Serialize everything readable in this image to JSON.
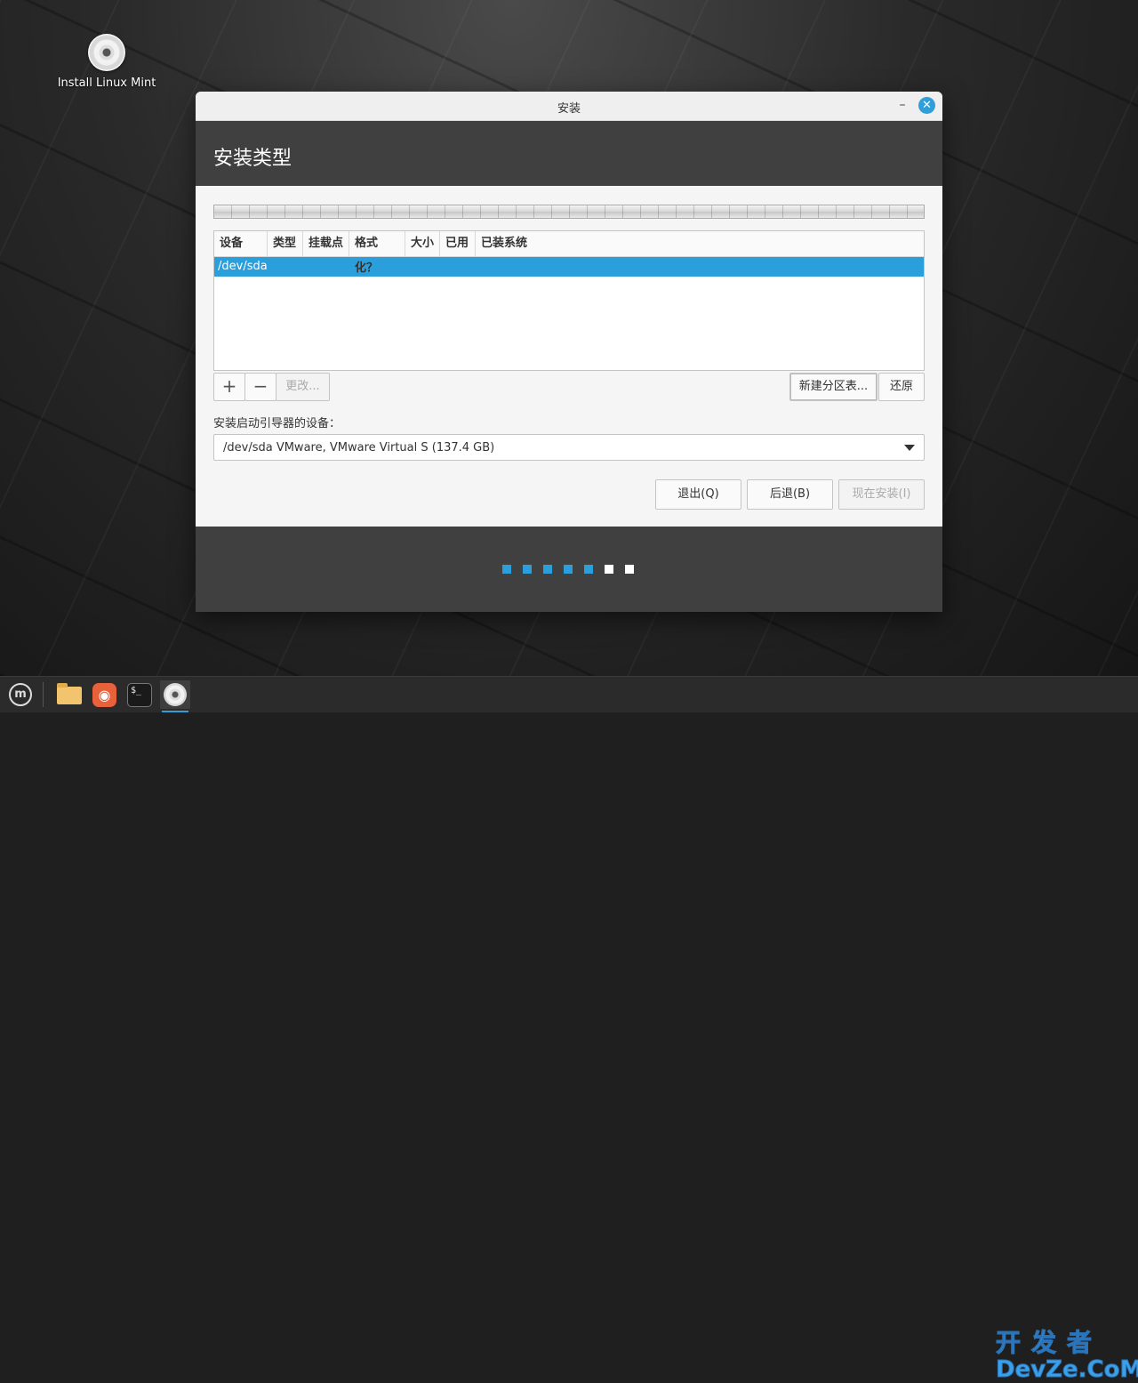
{
  "desktop": {
    "icon_label": "Install Linux Mint"
  },
  "window": {
    "title": "安装",
    "header_title": "安装类型",
    "table": {
      "columns": [
        {
          "label": "设备",
          "w": 60
        },
        {
          "label": "类型",
          "w": 40
        },
        {
          "label": "挂载点",
          "w": 52
        },
        {
          "label": "格式化？",
          "w": 63
        },
        {
          "label": "大小",
          "w": 39
        },
        {
          "label": "已用",
          "w": 40
        },
        {
          "label": "已装系统",
          "w": 504
        }
      ],
      "rows": [
        {
          "device": "/dev/sda"
        }
      ]
    },
    "buttons": {
      "add": "+",
      "remove": "−",
      "change": "更改...",
      "new_table": "新建分区表...",
      "revert": "还原",
      "quit": "退出(Q)",
      "back": "后退(B)",
      "install_now": "现在安装(I)"
    },
    "boot_label": "安装启动引导器的设备：",
    "boot_device": "/dev/sda VMware, VMware Virtual S (137.4 GB)",
    "progress": {
      "total": 7,
      "completed": 5,
      "active_color": "#2a9fdc",
      "inactive_color": "#ffffff"
    }
  },
  "watermark": {
    "line1": "开发者",
    "line2": "DevZe.CoM"
  },
  "colors": {
    "accent": "#2a9fdc",
    "header_bg": "#404040"
  }
}
